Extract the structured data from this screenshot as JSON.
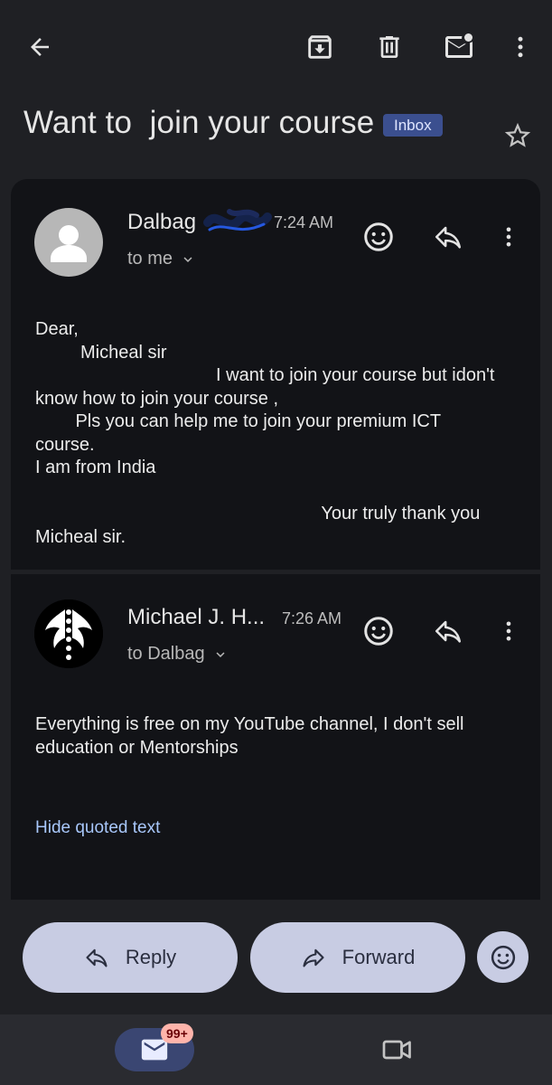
{
  "subject": {
    "title": "Want to  join your course",
    "label_badge": "Inbox"
  },
  "messages": [
    {
      "sender": "Dalbag",
      "time": "7:24 AM",
      "recipient": "to me",
      "body": "Dear,\n         Micheal sir\n                                    I want to join your course but idon't\nknow how to join your course ,\n        Pls you can help me to join your premium ICT\ncourse.\nI am from India\n\n                                                         Your truly thank you\nMicheal sir."
    },
    {
      "sender": "Michael J. H...",
      "time": "7:26 AM",
      "recipient": "to Dalbag",
      "body": "Everything is free on my YouTube channel, I don't sell\neducation or Mentorships",
      "quoted_link": "Hide quoted text"
    }
  ],
  "actions": {
    "reply_label": "Reply",
    "forward_label": "Forward"
  },
  "navbar": {
    "mail_badge": "99+"
  },
  "colors": {
    "background": "#1f2024",
    "card": "#121317",
    "badge": "#3b4f8f",
    "pill": "#c8cce3",
    "link": "#a8c7fa",
    "notification": "#ffb4ab"
  },
  "icons": {
    "back": "back-arrow-icon",
    "archive": "archive-icon",
    "delete": "trash-icon",
    "mark_unread": "mark-unread-icon",
    "more": "more-vert-icon",
    "star": "star-icon",
    "emoji": "emoji-icon",
    "reply": "reply-icon",
    "forward": "forward-icon",
    "mail": "mail-icon",
    "video": "video-icon"
  }
}
